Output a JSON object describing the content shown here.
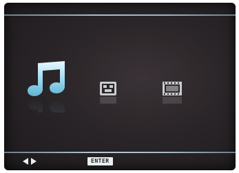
{
  "menu": {
    "items": [
      {
        "id": "music",
        "icon": "music-note-icon",
        "state": "selected"
      },
      {
        "id": "photo",
        "icon": "photo-icon",
        "state": "normal"
      },
      {
        "id": "movie",
        "icon": "film-strip-icon",
        "state": "normal"
      }
    ]
  },
  "footer": {
    "nav_icon": "left-right-arrows-icon",
    "enter_label": "ENTER"
  },
  "colors": {
    "selected_icon": "#8fd0e6",
    "normal_icon": "#c8cdd0",
    "rule": "#a9c0c9",
    "background": "#2a2528"
  }
}
